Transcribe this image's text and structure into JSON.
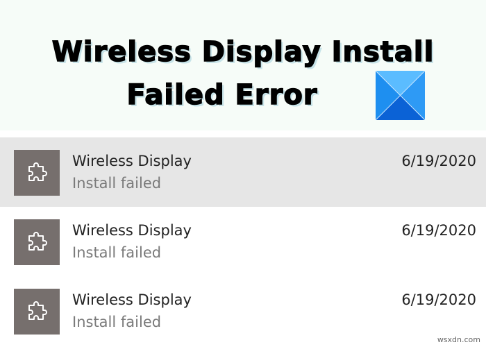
{
  "banner": {
    "title_line1": "Wireless Display Install",
    "title_line2": "Failed Error",
    "logo_icon": "windows-logo-icon"
  },
  "updates": [
    {
      "name": "Wireless Display",
      "status": "Install failed",
      "date": "6/19/2020",
      "icon": "puzzle-icon",
      "selected": true
    },
    {
      "name": "Wireless Display",
      "status": "Install failed",
      "date": "6/19/2020",
      "icon": "puzzle-icon",
      "selected": false
    },
    {
      "name": "Wireless Display",
      "status": "Install failed",
      "date": "6/19/2020",
      "icon": "puzzle-icon",
      "selected": false
    }
  ],
  "watermark": "wsxdn.com",
  "colors": {
    "tile": "#766f6d",
    "selected_row": "#e6e6e6",
    "banner_bg": "#f6fcf8",
    "windows_logo": "#1e7fe0"
  }
}
